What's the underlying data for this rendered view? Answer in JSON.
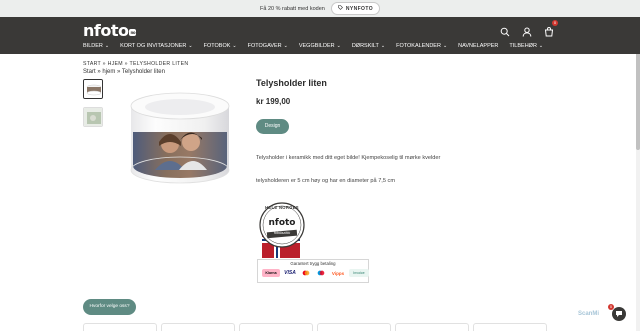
{
  "promo": {
    "text": "Få 20 % rabatt med koden",
    "code": "NYNFOTO"
  },
  "header": {
    "logo": "nfoto",
    "logo_badge": "no",
    "cart_count": "0",
    "nav": [
      {
        "label": "BILDER",
        "dropdown": true
      },
      {
        "label": "KORT OG INVITASJONER",
        "dropdown": true
      },
      {
        "label": "FOTOBOK",
        "dropdown": true
      },
      {
        "label": "FOTOGAVER",
        "dropdown": true
      },
      {
        "label": "VEGGBILDER",
        "dropdown": true
      },
      {
        "label": "DØRSKILT",
        "dropdown": true
      },
      {
        "label": "FOTOKALENDER",
        "dropdown": true
      },
      {
        "label": "NAVNELAPPER",
        "dropdown": false
      },
      {
        "label": "TILBEHØR",
        "dropdown": true
      }
    ]
  },
  "breadcrumb": {
    "upper": "START » HJEM » TELYSHOLDER LITEN",
    "lower": "Start » hjem » Telysholder liten"
  },
  "product": {
    "title": "Telysholder liten",
    "price": "kr 199,00",
    "design_label": "Design",
    "description_1": "Telysholder i keramikk med ditt eget bilde! Kjempekoselig til mørke kvelder",
    "description_2": "telysholderen er 5 cm høy og har en diameter på 7,5 cm"
  },
  "badge": {
    "top_text": "HELE NORGES",
    "logo": "nfoto",
    "bottom_text": "fotobutikk"
  },
  "payment": {
    "title": "Garantert trygg betaling",
    "methods": [
      "Klarna",
      "VISA",
      "Mastercard",
      "Maestro",
      "Vipps",
      "Invoice"
    ]
  },
  "help_button": "Hvorfor velge oss?",
  "chat": {
    "count": "0"
  },
  "scanner_text": "ScanMi",
  "colors": {
    "header_bg": "#3a3937",
    "accent": "#5f8b83",
    "badge_red": "#d2372f"
  }
}
